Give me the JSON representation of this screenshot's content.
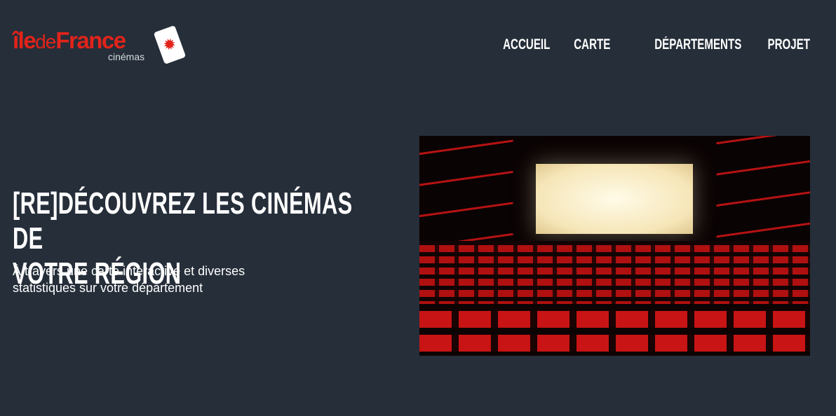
{
  "brand": {
    "logo_main_1": "île",
    "logo_main_2": "de",
    "logo_main_3": "France",
    "logo_sub": "cinémas",
    "accent": "#e2231a"
  },
  "nav": {
    "items": [
      {
        "label": "ACCUEIL"
      },
      {
        "label": "CARTE"
      },
      {
        "label": "DÉPARTEMENTS"
      },
      {
        "label": "PROJET"
      }
    ]
  },
  "hero": {
    "title_line1": "[RE]DÉCOUVREZ LES CINÉMAS DE",
    "title_line2": "VOTRE RÉGION",
    "subtitle_line1": "À travers une carte interactive et diverses",
    "subtitle_line2": "statistiques sur votre département",
    "image": "cinema-theater-photo"
  },
  "colors": {
    "background": "#252e39",
    "text": "#ffffff"
  }
}
